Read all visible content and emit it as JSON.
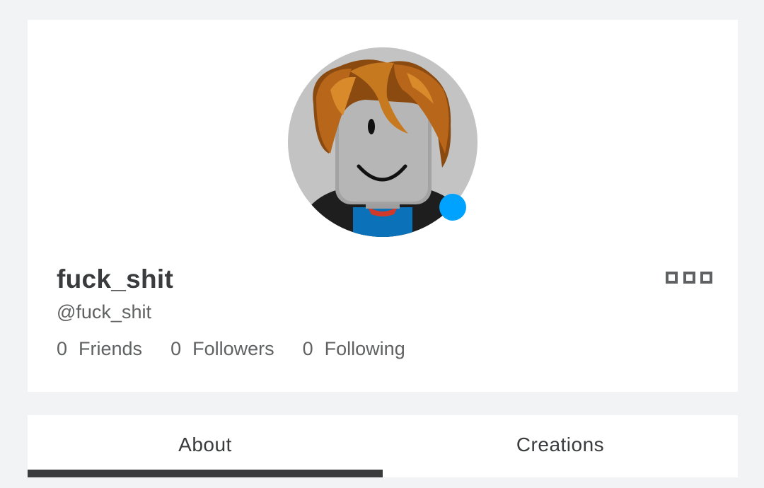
{
  "profile": {
    "display_name": "fuck_shit",
    "username": "@fuck_shit",
    "presence": "online",
    "presence_color": "#00a2ff",
    "avatar_icon": "roblox-avatar-headshot",
    "more_icon": "more-options-icon",
    "stats": [
      {
        "count": "0",
        "label": "Friends"
      },
      {
        "count": "0",
        "label": "Followers"
      },
      {
        "count": "0",
        "label": "Following"
      }
    ]
  },
  "tabs": [
    {
      "label": "About",
      "active": true
    },
    {
      "label": "Creations",
      "active": false
    }
  ],
  "colors": {
    "page_background": "#f2f3f5",
    "card_background": "#ffffff",
    "text_primary": "#393b3d",
    "text_secondary": "#606162",
    "tab_indicator": "#393b3d"
  }
}
